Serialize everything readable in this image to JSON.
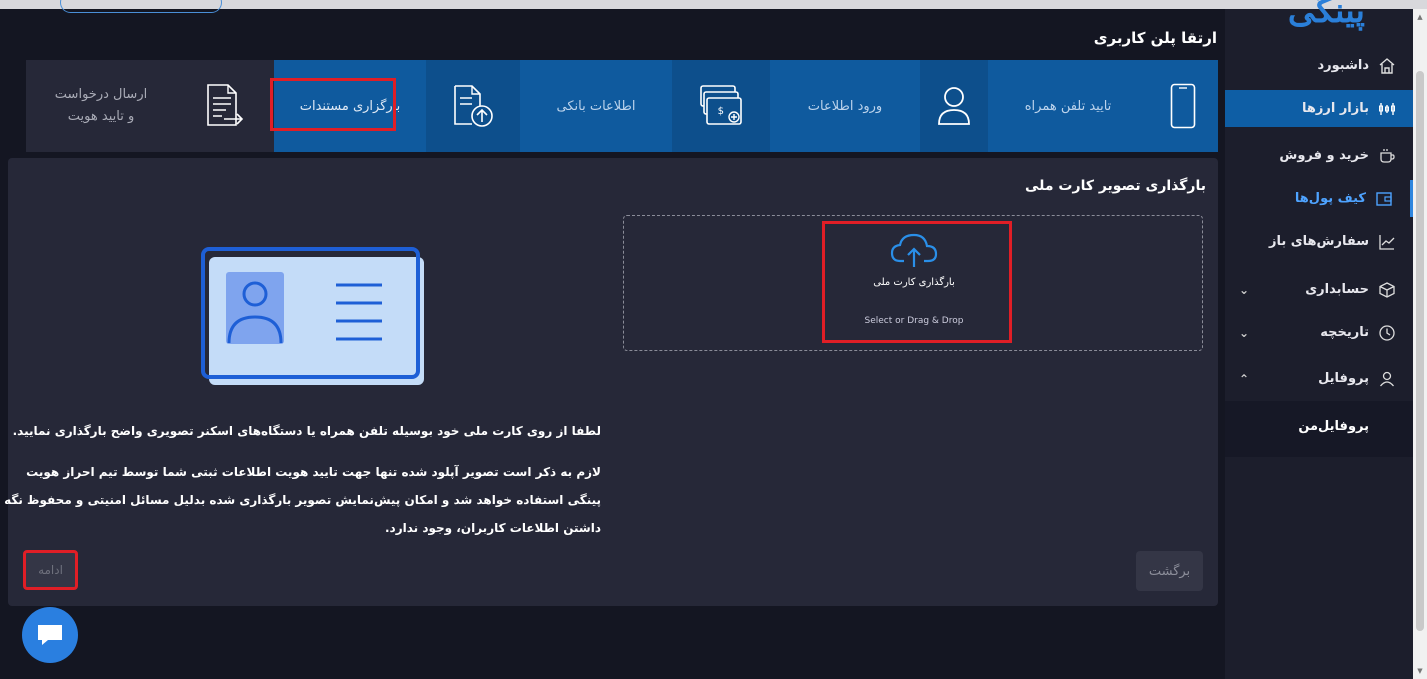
{
  "page_title": "ارتقا پلن کاربری",
  "brand": {
    "logo_text": "پینگی"
  },
  "sidebar": {
    "items": [
      {
        "label": "داشبورد",
        "icon": "home-icon"
      },
      {
        "label": "بازار ارزها",
        "icon": "market-icon",
        "active": true
      },
      {
        "label": "خرید و فروش",
        "icon": "cup-icon"
      },
      {
        "label": "کیف پول‌ها",
        "icon": "wallet-icon",
        "highlighted": true
      },
      {
        "label": "سفارش‌های باز",
        "icon": "chart-icon"
      },
      {
        "label": "حسابداری",
        "icon": "cube-icon",
        "expandable": true
      },
      {
        "label": "تاریخچه",
        "icon": "clock-icon",
        "expandable": true
      },
      {
        "label": "پروفایل",
        "icon": "user-icon",
        "expanded": true
      }
    ],
    "sub_items": [
      {
        "label": "پروفایل‌من"
      }
    ]
  },
  "steps": {
    "phone": "تایید تلفن همراه",
    "info": "ورود اطلاعات",
    "bank": "اطلاعات بانکی",
    "upload": "بارگزاری مستندات",
    "send_line1": "ارسال درخواست",
    "send_line2": "و تایید هویت"
  },
  "card": {
    "title": "بارگذاری تصویر کارت ملی",
    "upload_title": "بارگذاری کارت ملی",
    "upload_hint": "Select or Drag & Drop",
    "text1_a": "لطفا از روی کارت ملی خود بوسیله تلفن همراه یا دستگاه‌های اسکنر ",
    "text1_b": "تصویری واضح",
    "text1_c": " بارگذاری نمایید.",
    "text2": "لازم به ذکر است تصویر آپلود شده تنها جهت تایید هویت اطلاعات ثبتی شما توسط تیم احراز هویت پینگی استفاده خواهد شد و امکان پیش‌نمایش تصویر بارگذاری شده بدلیل مسائل امنیتی و محفوظ نگه داشتن اطلاعات کاربران، وجود ندارد."
  },
  "buttons": {
    "back": "برگشت",
    "next": "ادامه"
  },
  "colors": {
    "accent": "#2a7fe0",
    "step_active": "#0f5a9e",
    "highlight_box": "#e01e26",
    "background": "#141622",
    "card": "#262838"
  }
}
